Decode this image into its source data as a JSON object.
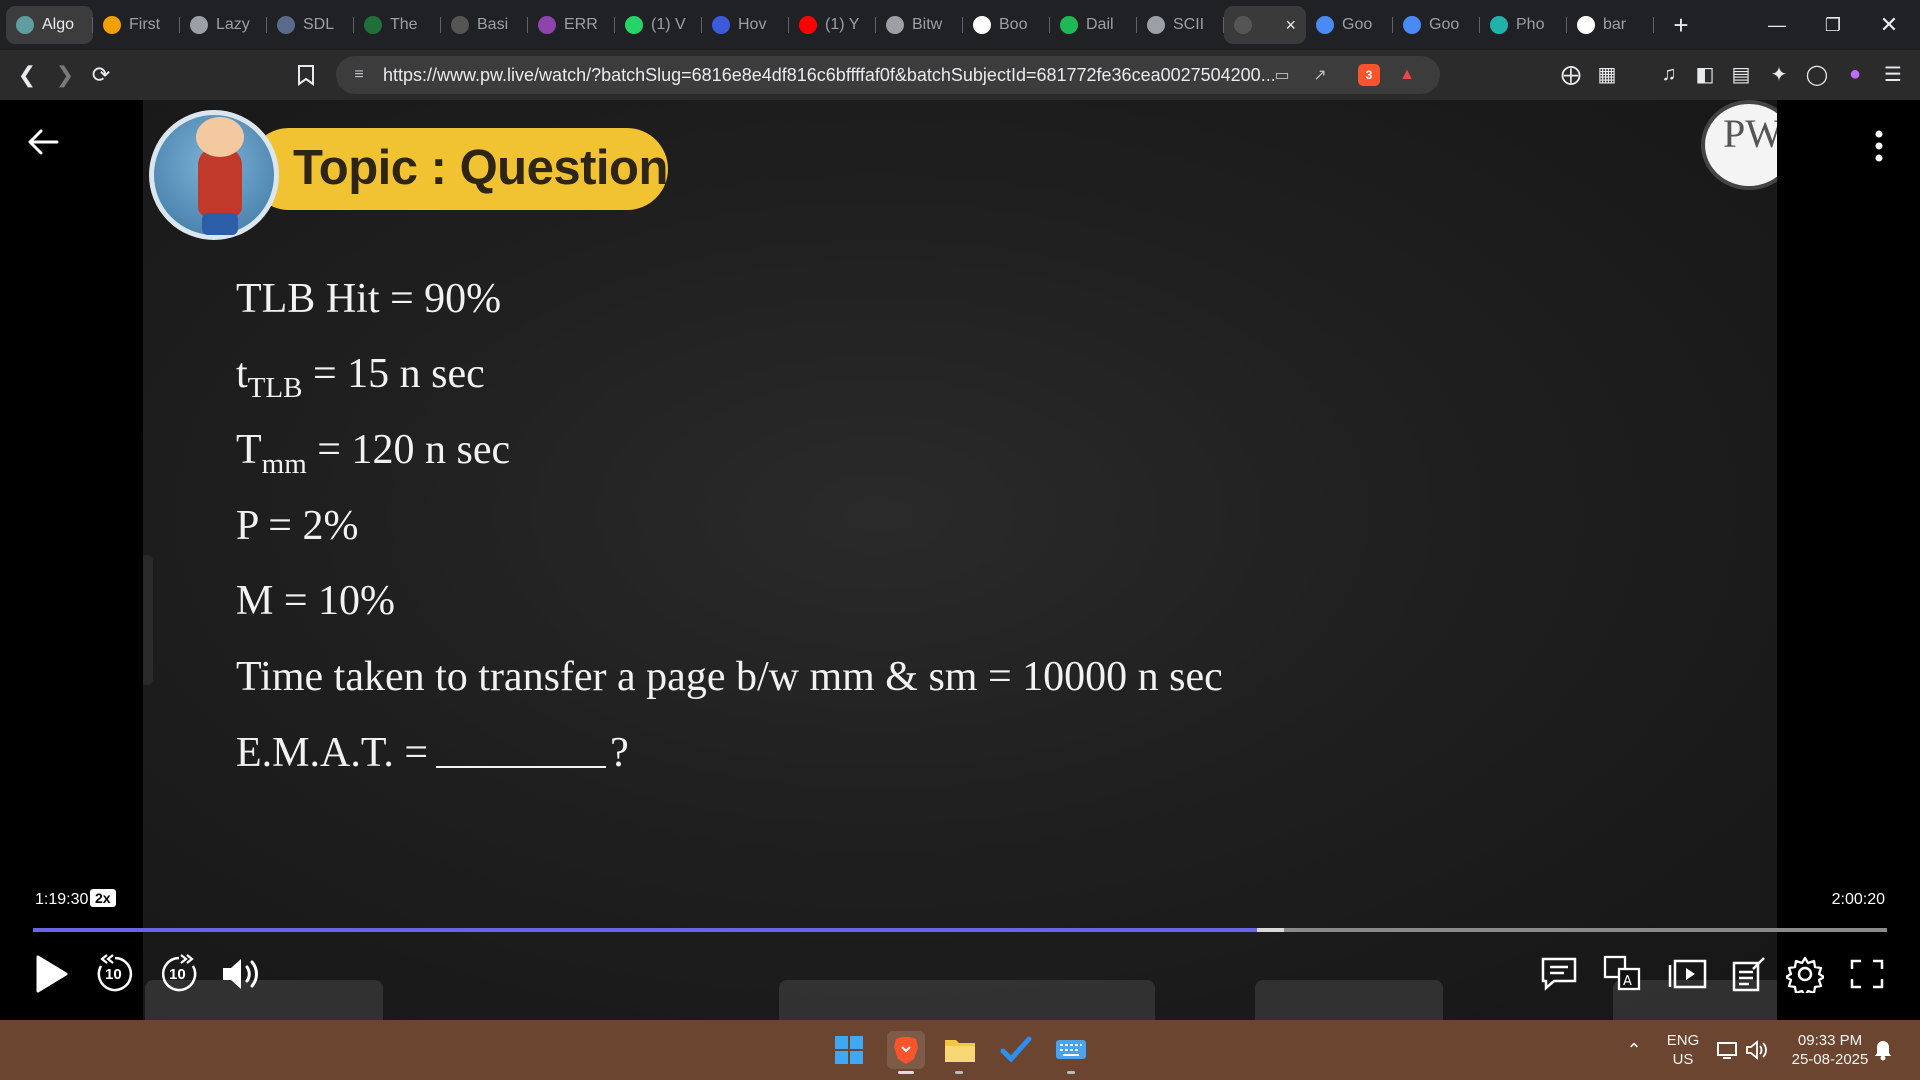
{
  "browser": {
    "tabs": [
      {
        "label": "Algo",
        "icon": "chat-icon",
        "color": "#5f9ea0"
      },
      {
        "label": "First",
        "icon": "bolt-icon",
        "color": "#f0a000"
      },
      {
        "label": "Lazy",
        "icon": "globe-icon",
        "color": "#9aa0a6"
      },
      {
        "label": "SDL",
        "icon": "page-icon",
        "color": "#5a6a8a"
      },
      {
        "label": "The",
        "icon": "w3-icon",
        "color": "#1f6f3a"
      },
      {
        "label": "Basi",
        "icon": "page-icon",
        "color": "#555555"
      },
      {
        "label": "ERR",
        "icon": "wheel-icon",
        "color": "#8e44ad"
      },
      {
        "label": "(1) V",
        "icon": "whatsapp-icon",
        "color": "#25d366"
      },
      {
        "label": "Hov",
        "icon": "bookmark-icon",
        "color": "#3b5bdb"
      },
      {
        "label": "(1) Y",
        "icon": "youtube-icon",
        "color": "#ff0000"
      },
      {
        "label": "Bitw",
        "icon": "text-icon",
        "color": "#9aa0a6"
      },
      {
        "label": "Boo",
        "icon": "google-icon",
        "color": "#ffffff"
      },
      {
        "label": "Dail",
        "icon": "spotify-icon",
        "color": "#1db954"
      },
      {
        "label": "SCII",
        "icon": "globe-icon",
        "color": "#9aa0a6"
      },
      {
        "label": "",
        "icon": "loading-icon",
        "color": "#555555",
        "active": true
      },
      {
        "label": "Goo",
        "icon": "gemini-icon",
        "color": "#4a8af4"
      },
      {
        "label": "Goo",
        "icon": "gemini-icon",
        "color": "#4a8af4"
      },
      {
        "label": "Pho",
        "icon": "perplexity-icon",
        "color": "#20b2aa"
      },
      {
        "label": "bar",
        "icon": "google-icon",
        "color": "#ffffff"
      }
    ],
    "url": "https://www.pw.live/watch/?batchSlug=6816e8e4df816c6bffffaf0f&batchSubjectId=681772fe36cea0027504200...",
    "shield_badge": "3"
  },
  "video": {
    "topic": "Topic : Question",
    "logo": "PW",
    "lines": [
      {
        "main": "TLB Hit = 90%",
        "sub": "",
        "rest": ""
      },
      {
        "main": "t",
        "sub": "TLB",
        "rest": " = 15 n sec"
      },
      {
        "main": "T",
        "sub": "mm",
        "rest": " = 120 n sec"
      },
      {
        "main": "P = 2%",
        "sub": "",
        "rest": ""
      },
      {
        "main": "M = 10%",
        "sub": "",
        "rest": ""
      },
      {
        "main": "Time taken to transfer a page b/w mm & sm = 10000 n sec",
        "sub": "",
        "rest": ""
      }
    ],
    "emat_label": "E.M.A.T. =",
    "emat_suffix": "?"
  },
  "player": {
    "current_time": "1:19:30",
    "speed": "2x",
    "total_time": "2:00:20",
    "progress_fraction": 0.66,
    "buffered_fraction": 0.675,
    "rewind_label": "10",
    "forward_label": "10",
    "accent": "#6b63e8"
  },
  "taskbar": {
    "lang_top": "ENG",
    "lang_bottom": "US",
    "time": "09:33 PM",
    "date": "25-08-2025"
  }
}
